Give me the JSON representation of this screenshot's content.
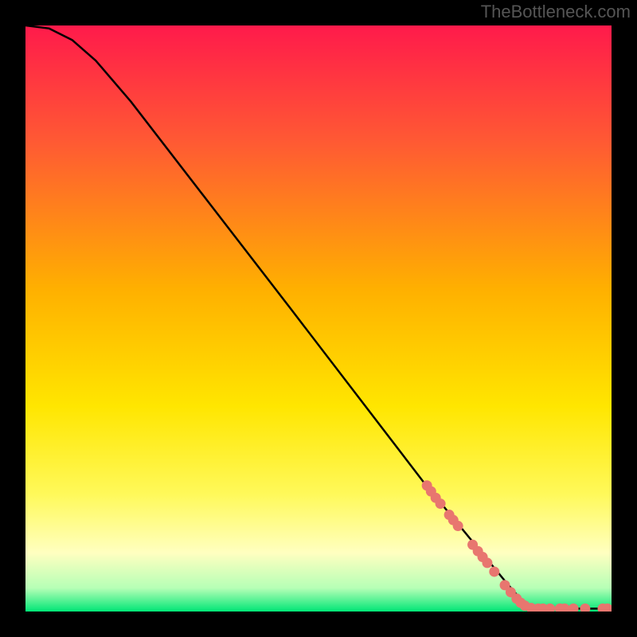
{
  "watermark": "TheBottleneck.com",
  "chart_data": {
    "type": "line",
    "title": "",
    "xlabel": "",
    "ylabel": "",
    "xlim": [
      0,
      100
    ],
    "ylim": [
      0,
      100
    ],
    "background": {
      "type": "vertical-gradient",
      "stops": [
        {
          "offset": 0.0,
          "color": "#ff1a4b"
        },
        {
          "offset": 0.2,
          "color": "#ff5a33"
        },
        {
          "offset": 0.45,
          "color": "#ffb000"
        },
        {
          "offset": 0.65,
          "color": "#ffe600"
        },
        {
          "offset": 0.8,
          "color": "#fff95a"
        },
        {
          "offset": 0.9,
          "color": "#ffffc0"
        },
        {
          "offset": 0.96,
          "color": "#b6ffb6"
        },
        {
          "offset": 1.0,
          "color": "#00e676"
        }
      ]
    },
    "series": [
      {
        "name": "curve",
        "color": "#000000",
        "points": [
          {
            "x": 0,
            "y": 100
          },
          {
            "x": 4,
            "y": 99.5
          },
          {
            "x": 8,
            "y": 97.5
          },
          {
            "x": 12,
            "y": 94
          },
          {
            "x": 18,
            "y": 87
          },
          {
            "x": 45,
            "y": 52
          },
          {
            "x": 68,
            "y": 22
          },
          {
            "x": 82,
            "y": 5
          },
          {
            "x": 85,
            "y": 1.5
          },
          {
            "x": 88,
            "y": 0.5
          },
          {
            "x": 100,
            "y": 0.5
          }
        ]
      }
    ],
    "highlights": {
      "color": "#e8766f",
      "points": [
        {
          "x": 68.5,
          "y": 21.5
        },
        {
          "x": 69.2,
          "y": 20.5
        },
        {
          "x": 70.0,
          "y": 19.4
        },
        {
          "x": 70.8,
          "y": 18.4
        },
        {
          "x": 72.3,
          "y": 16.5
        },
        {
          "x": 73.0,
          "y": 15.6
        },
        {
          "x": 73.8,
          "y": 14.6
        },
        {
          "x": 76.3,
          "y": 11.4
        },
        {
          "x": 77.2,
          "y": 10.3
        },
        {
          "x": 78.0,
          "y": 9.3
        },
        {
          "x": 78.8,
          "y": 8.3
        },
        {
          "x": 80.0,
          "y": 6.8
        },
        {
          "x": 81.8,
          "y": 4.5
        },
        {
          "x": 82.8,
          "y": 3.3
        },
        {
          "x": 83.8,
          "y": 2.2
        },
        {
          "x": 84.5,
          "y": 1.5
        },
        {
          "x": 85.2,
          "y": 1.0
        },
        {
          "x": 86.3,
          "y": 0.6
        },
        {
          "x": 87.5,
          "y": 0.5
        },
        {
          "x": 88.3,
          "y": 0.5
        },
        {
          "x": 89.5,
          "y": 0.5
        },
        {
          "x": 91.2,
          "y": 0.5
        },
        {
          "x": 92.0,
          "y": 0.5
        },
        {
          "x": 93.5,
          "y": 0.5
        },
        {
          "x": 95.5,
          "y": 0.5
        },
        {
          "x": 98.5,
          "y": 0.5
        },
        {
          "x": 99.3,
          "y": 0.5
        }
      ]
    }
  }
}
